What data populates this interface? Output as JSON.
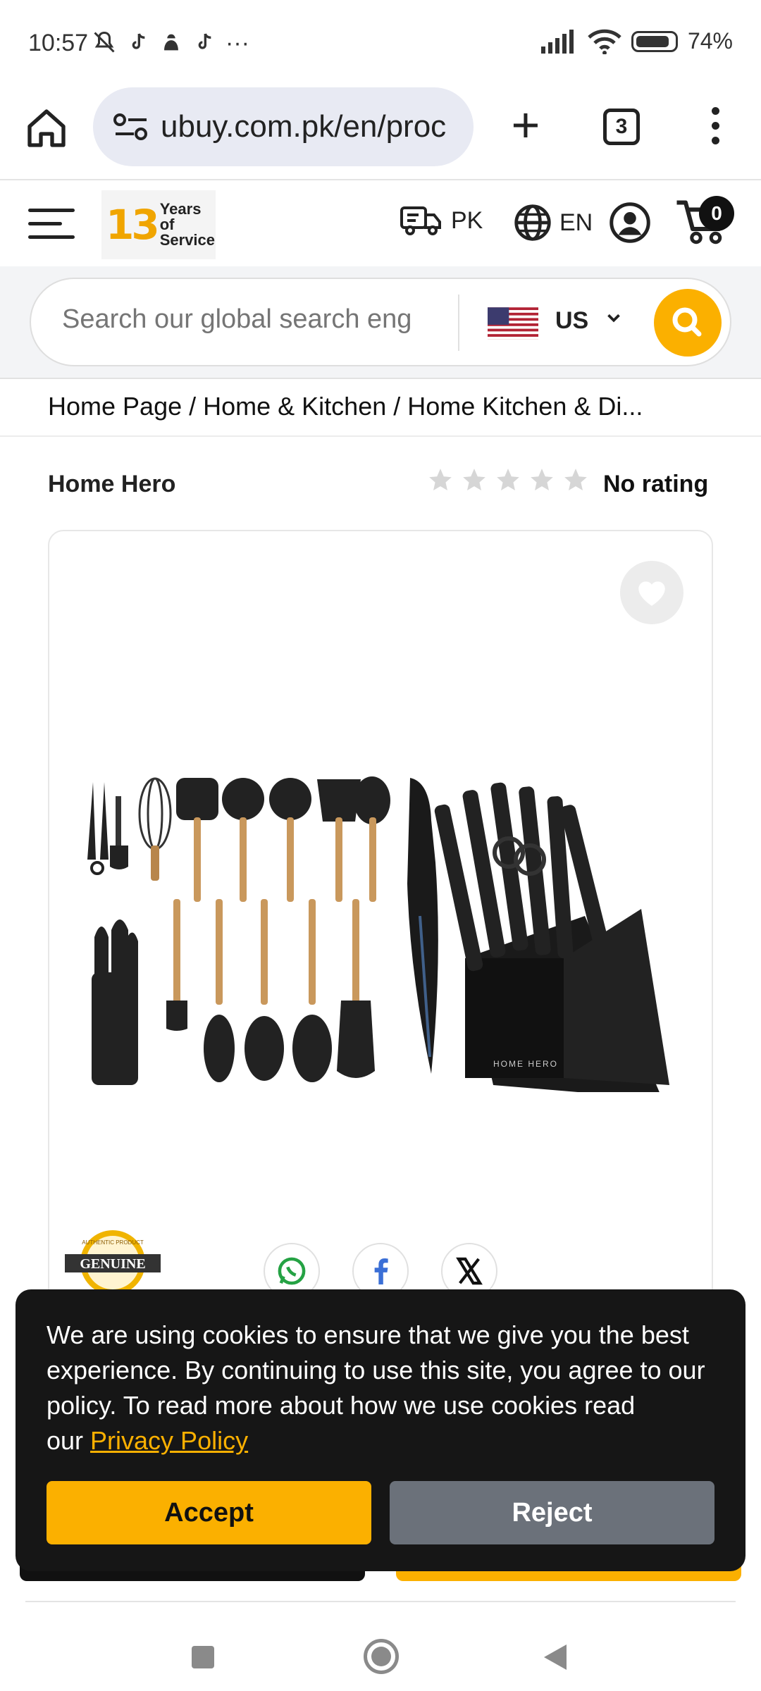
{
  "status_bar": {
    "time": "10:57",
    "notification_icons": [
      "mute-bell-icon",
      "tiktok-icon",
      "app-icon",
      "tiktok-icon"
    ],
    "more": "···",
    "battery": "74%"
  },
  "browser": {
    "url": "ubuy.com.pk/en/proc",
    "tab_count": "3"
  },
  "header": {
    "logo_number": "13",
    "logo_line1": "Years of",
    "logo_line2": "Service",
    "ship_to": "PK",
    "language": "EN",
    "cart_count": "0"
  },
  "search": {
    "placeholder": "Search our global search eng",
    "country": "US"
  },
  "breadcrumb": "Home Page / Home & Kitchen / Home Kitchen & Di...",
  "product": {
    "brand": "Home Hero",
    "rating_text": "No rating",
    "rating_value": 0,
    "stars_total": 5,
    "badge_text": "GENUINE",
    "badge_subtext": "AUTHENTIC PRODUCT",
    "image_label": "HOME HERO"
  },
  "share": {
    "items": [
      "whatsapp-icon",
      "facebook-icon",
      "x-icon"
    ]
  },
  "cookie": {
    "message": "We are using cookies to ensure that we give you the best experience. By continuing to use this site, you agree to our policy. To read more about how we use cookies read our",
    "link": "Privacy Policy",
    "accept": "Accept",
    "reject": "Reject"
  },
  "colors": {
    "accent": "#fbb000",
    "cookie_bg": "#161616",
    "reject_bg": "#6b717a"
  }
}
